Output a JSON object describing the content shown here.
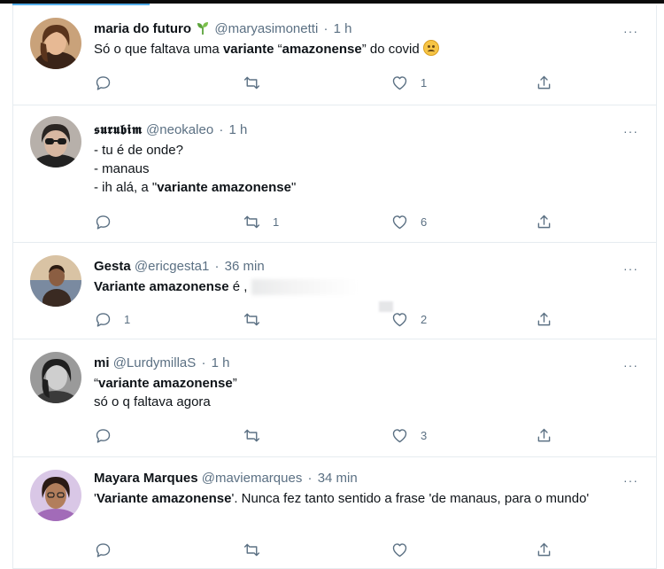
{
  "tweets": [
    {
      "name": "maria do futuro",
      "name_badge": "🌱",
      "handle": "@maryasimonetti",
      "separator": "·",
      "time": "1 h",
      "text_plain_1": "Só o que faltava uma ",
      "text_bold_1": "variante",
      "text_plain_2": " “",
      "text_bold_2": "amazonense",
      "text_plain_3": "” do covid ",
      "emoji": "🥴",
      "replies": "",
      "retweets": "",
      "likes": "1",
      "more": "···"
    },
    {
      "name": "𝖘𝖚𝖗𝖚𝖇𝖎𝖒",
      "handle": "@neokaleo",
      "separator": "·",
      "time": "1 h",
      "line1": "- tu é de onde?",
      "line2": "- manaus",
      "line3_plain": "- ih alá, a \"",
      "line3_bold": "variante amazonense",
      "line3_end": "\"",
      "replies": "",
      "retweets": "1",
      "likes": "6",
      "more": "···"
    },
    {
      "name": "Gesta",
      "handle": "@ericgesta1",
      "separator": "·",
      "time": "36 min",
      "text_bold": "Variante amazonense",
      "text_plain": " é ,",
      "replies": "1",
      "retweets": "",
      "likes": "2",
      "more": "···"
    },
    {
      "name": "mi",
      "handle": "@LurdymillaS",
      "separator": "·",
      "time": "1 h",
      "line1_open": "“",
      "line1_bold": "variante amazonense",
      "line1_close": "”",
      "line2": "só o q faltava agora",
      "replies": "",
      "retweets": "",
      "likes": "3",
      "more": "···"
    },
    {
      "name": "Mayara Marques",
      "handle": "@maviemarques",
      "separator": "·",
      "time": "34 min",
      "text_open": "'",
      "text_bold": "Variante amazonense",
      "text_plain": "'. Nunca fez tanto sentido a frase 'de manaus, para o mundo'",
      "replies": "",
      "retweets": "",
      "likes": "",
      "more": "···"
    }
  ],
  "colors": {
    "muted": "#5b7083",
    "border": "#e6ecf0",
    "text": "#0f1419",
    "accent": "#55aeea"
  },
  "icons": {
    "reply": "reply-icon",
    "retweet": "retweet-icon",
    "like": "like-icon",
    "share": "share-icon"
  }
}
